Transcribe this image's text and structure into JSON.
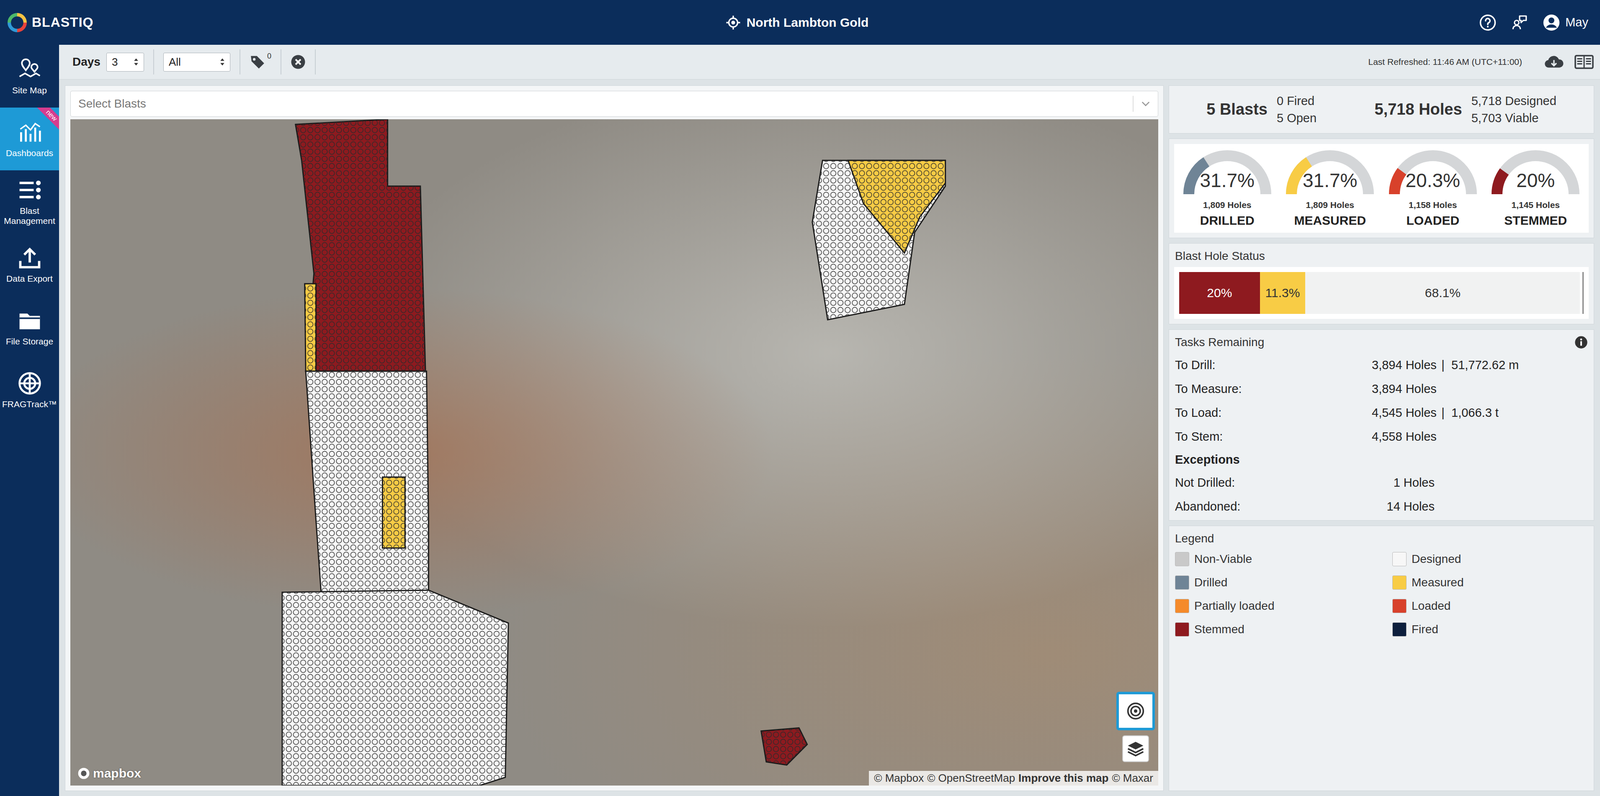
{
  "header": {
    "brand": "BLASTIQ",
    "site": "North Lambton Gold",
    "user": "May"
  },
  "sidebar": {
    "items": [
      {
        "label": "Site Map",
        "selected": false,
        "badge": null,
        "icon": "map"
      },
      {
        "label": "Dashboards",
        "selected": true,
        "badge": "new",
        "icon": "chart"
      },
      {
        "label": "Blast Management",
        "selected": false,
        "badge": null,
        "icon": "list"
      },
      {
        "label": "Data Export",
        "selected": false,
        "badge": null,
        "icon": "upload"
      },
      {
        "label": "File Storage",
        "selected": false,
        "badge": null,
        "icon": "folder"
      },
      {
        "label": "FRAGTrack™",
        "selected": false,
        "badge": null,
        "icon": "frag"
      }
    ]
  },
  "toolbar": {
    "days_label": "Days",
    "days_value": "3",
    "filter_value": "All",
    "tag_count": "0",
    "last_refreshed": "Last Refreshed: 11:46 AM (UTC+11:00)"
  },
  "blast_select": {
    "placeholder": "Select Blasts"
  },
  "map": {
    "logo": "mapbox",
    "locate_active": true,
    "attribution": [
      {
        "text": "© Mapbox",
        "bold": false
      },
      {
        "text": "© OpenStreetMap",
        "bold": false
      },
      {
        "text": "Improve this map",
        "bold": true
      },
      {
        "text": "© Maxar",
        "bold": false
      }
    ]
  },
  "summary": {
    "blasts": "5 Blasts",
    "fired": "0 Fired",
    "open": "5 Open",
    "holes": "5,718 Holes",
    "designed": "5,718 Designed",
    "viable": "5,703 Viable"
  },
  "gauges": [
    {
      "percent": "31.7%",
      "holes": "1,809 Holes",
      "label": "DRILLED",
      "level": 0.317,
      "color": "#6f8496"
    },
    {
      "percent": "31.7%",
      "holes": "1,809 Holes",
      "label": "MEASURED",
      "level": 0.317,
      "color": "#f8cc45"
    },
    {
      "percent": "20.3%",
      "holes": "1,158 Holes",
      "label": "LOADED",
      "level": 0.203,
      "color": "#d8412b"
    },
    {
      "percent": "20%",
      "holes": "1,145 Holes",
      "label": "STEMMED",
      "level": 0.2,
      "color": "#8e1a1f"
    }
  ],
  "hole_status": {
    "title": "Blast Hole Status",
    "segments": [
      {
        "label": "20%",
        "level": 0.2,
        "color": "#8e1a1f"
      },
      {
        "label": "11.3%",
        "level": 0.113,
        "color": "#f8cc45"
      },
      {
        "label": "68.1%",
        "level": 0.681,
        "color": "#f1f2f2"
      }
    ]
  },
  "tasks": {
    "title": "Tasks Remaining",
    "separator": "|",
    "rows": [
      {
        "label": "To Drill:",
        "value": "3,894 Holes",
        "extra": "51,772.62 m"
      },
      {
        "label": "To Measure:",
        "value": "3,894 Holes",
        "extra": null
      },
      {
        "label": "To Load:",
        "value": "4,545 Holes",
        "extra": "1,066.3 t"
      },
      {
        "label": "To Stem:",
        "value": "4,558 Holes",
        "extra": null
      }
    ],
    "exceptions_title": "Exceptions",
    "exceptions": [
      {
        "label": "Not Drilled:",
        "value": "1 Holes"
      },
      {
        "label": "Abandoned:",
        "value": "14 Holes"
      }
    ]
  },
  "legend": {
    "title": "Legend",
    "items": [
      {
        "label": "Non-Viable",
        "color": "#c9c9c9"
      },
      {
        "label": "Designed",
        "color": "#f7f7f7"
      },
      {
        "label": "Drilled",
        "color": "#6f8496"
      },
      {
        "label": "Measured",
        "color": "#f8cc45"
      },
      {
        "label": "Partially loaded",
        "color": "#f58a2a"
      },
      {
        "label": "Loaded",
        "color": "#d8412b"
      },
      {
        "label": "Stemmed",
        "color": "#8e1a1f"
      },
      {
        "label": "Fired",
        "color": "#0d1f3d"
      }
    ]
  }
}
